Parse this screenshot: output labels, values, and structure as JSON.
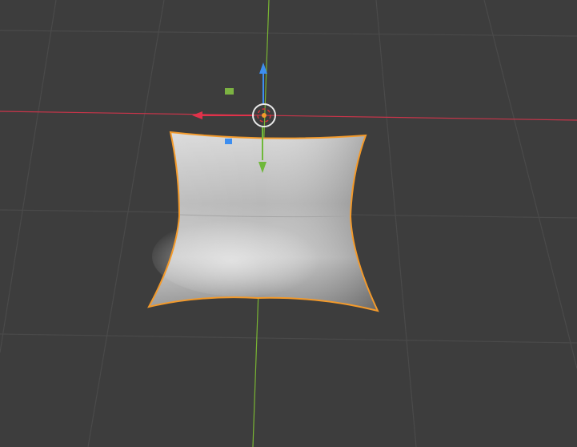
{
  "viewport": {
    "background_color": "#3d3d3d",
    "grid_color": "#4a4a4a",
    "x_axis_color": "#c8354a",
    "y_axis_color": "#79b533",
    "selection_outline_color": "#f39a2b"
  },
  "object": {
    "name": "pillow",
    "selected": true,
    "shading": "solid"
  },
  "gizmo": {
    "type": "translate",
    "x_color": "#e0324a",
    "y_color": "#6fb83a",
    "z_color": "#3d8ef0",
    "plane_handle_color": "#7cb342"
  },
  "icons": {
    "origin": "object-origin-icon",
    "pivot": "pivot-point-icon"
  }
}
